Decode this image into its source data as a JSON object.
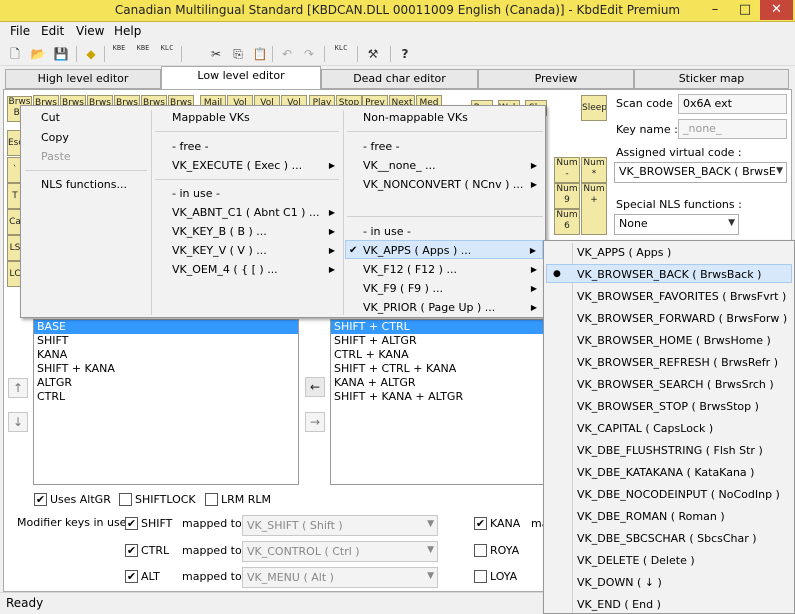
{
  "window": {
    "title": "Canadian Multilingual Standard [KBDCAN.DLL 00011009 English (Canada)] - KbdEdit Premium",
    "minimize": "–",
    "maximize": "□",
    "close": "✕"
  },
  "menubar": {
    "file": "File",
    "edit": "Edit",
    "view": "View",
    "help": "Help"
  },
  "toolbar": {
    "new": "🗋",
    "open": "📂",
    "save": "💾",
    "gen": "◆",
    "kbe1": "KBE",
    "kbe2": "KBE",
    "klc": "KLC",
    "cut": "✂",
    "copy": "⎘",
    "paste": "📋",
    "undo": "↶",
    "redo": "↷",
    "klc_import": "KLC",
    "tools": "⚒",
    "help": "?"
  },
  "tabs": [
    "High level editor",
    "Low level editor",
    "Dead char editor",
    "Preview",
    "Sticker map"
  ],
  "keyboard": {
    "row1": [
      "Brws Ba",
      "Brws",
      "Brws",
      "Brws",
      "Brws",
      "Brws",
      "Brws",
      "Mail",
      "Vol",
      "Vol",
      "Vol",
      "Play",
      "Stop",
      "Prev",
      "Next",
      "Med"
    ],
    "row1_right": [
      "Pwr",
      "Wake",
      "Slp",
      "Sleep"
    ],
    "left_keys": [
      "Esc",
      "`",
      "T",
      "Ca",
      "LS",
      "LC"
    ],
    "numpad": [
      {
        "top": "Num",
        "bot": "-"
      },
      {
        "top": "Num",
        "bot": "*"
      },
      {
        "top": "Num",
        "bot": "9"
      },
      {
        "top": "Num",
        "bot": "+"
      },
      {
        "top": "Num",
        "bot": "6"
      }
    ]
  },
  "props": {
    "scan_code_label": "Scan code",
    "scan_code_value": "0x6A ext",
    "key_name_label": "Key name :",
    "key_name_value": "_none_",
    "assigned_vk_label": "Assigned virtual code :",
    "assigned_vk_value": "VK_BROWSER_BACK ( BrwsE",
    "special_nls_label": "Special NLS functions :",
    "special_nls_value": "None"
  },
  "left_list": [
    "BASE",
    "SHIFT",
    "KANA",
    "SHIFT + KANA",
    "ALTGR",
    "CTRL"
  ],
  "right_list": [
    "SHIFT + CTRL",
    "SHIFT + ALTGR",
    "CTRL + KANA",
    "SHIFT + CTRL + KANA",
    "KANA + ALTGR",
    "SHIFT + KANA + ALTGR"
  ],
  "move": {
    "up": "↑",
    "down": "↓",
    "left": "←",
    "right": "→"
  },
  "options": {
    "uses_altgr": "Uses AltGR",
    "shiftlock": "SHIFTLOCK",
    "lrm_rlm": "LRM RLM",
    "check": "✔"
  },
  "modifiers": {
    "title": "Modifier keys in use :",
    "mapped_to": "mapped to",
    "rows": [
      {
        "name": "SHIFT",
        "vk": "VK_SHIFT ( Shift )"
      },
      {
        "name": "CTRL",
        "vk": "VK_CONTROL ( Ctrl )"
      },
      {
        "name": "ALT",
        "vk": "VK_MENU ( Alt )"
      }
    ],
    "right": [
      {
        "name": "KANA",
        "extra": "ma"
      },
      {
        "name": "ROYA",
        "extra": ""
      },
      {
        "name": "LOYA",
        "extra": ""
      }
    ]
  },
  "status": {
    "text": "Ready"
  },
  "context_menu": {
    "edit_items": [
      "Cut",
      "Copy",
      "Paste",
      "NLS functions..."
    ],
    "mappable": {
      "header": "Mappable VKs",
      "free_header": "- free -",
      "free": [
        "VK_EXECUTE ( Exec ) ..."
      ],
      "inuse_header": "- in use -",
      "inuse": [
        "VK_ABNT_C1 ( Abnt  C1 ) ...",
        "VK_KEY_B ( B ) ...",
        "VK_KEY_V ( V ) ...",
        "VK_OEM_4 ( {    [    ) ..."
      ]
    },
    "nonmappable": {
      "header": "Non-mappable VKs",
      "free_header": "- free -",
      "free": [
        "VK__none_ ...",
        "VK_NONCONVERT ( NCnv ) ..."
      ],
      "inuse_header": "- in use -",
      "inuse": [
        "VK_APPS ( Apps ) ...",
        "VK_F12 ( F12 ) ...",
        "VK_F9 ( F9 ) ...",
        "VK_PRIOR ( Page Up ) ..."
      ]
    },
    "submenu": [
      "VK_APPS ( Apps )",
      "VK_BROWSER_BACK ( BrwsBack )",
      "VK_BROWSER_FAVORITES ( BrwsFvrt )",
      "VK_BROWSER_FORWARD ( BrwsForw )",
      "VK_BROWSER_HOME ( BrwsHome )",
      "VK_BROWSER_REFRESH ( BrwsRefr )",
      "VK_BROWSER_SEARCH ( BrwsSrch )",
      "VK_BROWSER_STOP ( BrwsStop )",
      "VK_CAPITAL ( CapsLock )",
      "VK_DBE_FLUSHSTRING ( Flsh Str )",
      "VK_DBE_KATAKANA ( KataKana )",
      "VK_DBE_NOCODEINPUT ( NoCodInp )",
      "VK_DBE_ROMAN ( Roman )",
      "VK_DBE_SBCSCHAR ( SbcsChar )",
      "VK_DELETE ( Delete )",
      "VK_DOWN ( ↓ )",
      "VK_END ( End )"
    ],
    "check": "✔",
    "bullet": "●",
    "arrow": "▶"
  }
}
